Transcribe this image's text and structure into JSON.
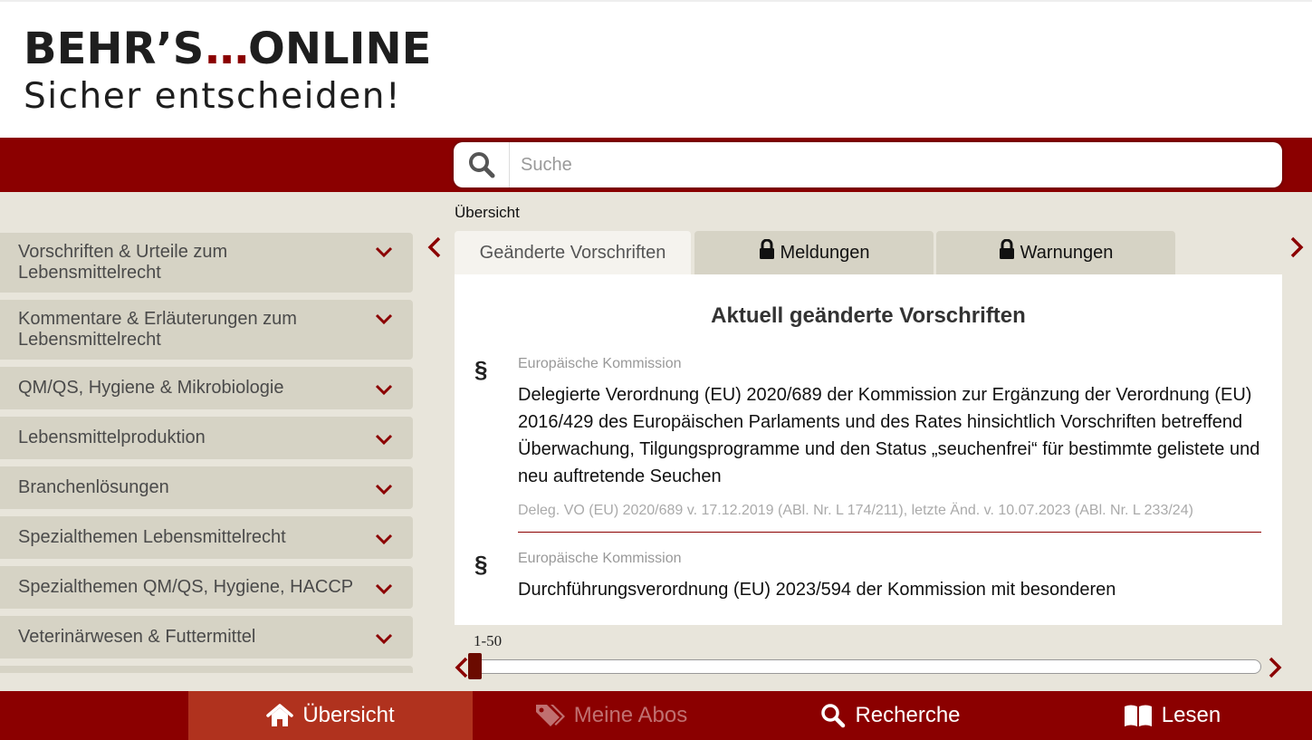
{
  "logo": {
    "brand_left": "BEHR’S",
    "brand_dots": "...",
    "brand_right": "ONLINE",
    "tagline": "Sicher entscheiden!"
  },
  "colors": {
    "brand_red": "#8b0000",
    "active_nav": "#b0321e",
    "sidebar_bg": "#d6d3c5",
    "main_bg": "#e8e5db"
  },
  "search": {
    "placeholder": "Suche",
    "icon": "search-icon"
  },
  "breadcrumb": "Übersicht",
  "sidebar": {
    "items": [
      {
        "label": "Vorschriften & Urteile zum Lebensmittelrecht"
      },
      {
        "label": "Kommentare & Erläuterungen zum Lebensmittelrecht"
      },
      {
        "label": "QM/QS, Hygiene & Mikrobiologie"
      },
      {
        "label": "Lebensmittelproduktion"
      },
      {
        "label": "Branchenlösungen"
      },
      {
        "label": "Spezialthemen Lebensmittelrecht"
      },
      {
        "label": "Spezialthemen QM/QS, Hygiene, HACCP"
      },
      {
        "label": "Veterinärwesen & Futtermittel"
      }
    ]
  },
  "tabs": [
    {
      "label": "Geänderte Vorschriften",
      "active": true,
      "locked": false
    },
    {
      "label": "Meldungen",
      "active": false,
      "locked": true
    },
    {
      "label": "Warnungen",
      "active": false,
      "locked": true
    }
  ],
  "content": {
    "heading": "Aktuell geänderte Vorschriften",
    "entries": [
      {
        "symbol": "§",
        "issuer": "Europäische Kommission",
        "title": "Delegierte Verordnung (EU) 2020/689 der Kommission zur Ergänzung der Verordnung (EU) 2016/429 des Europäischen Parlaments und des Rates hinsichtlich Vorschriften betreffend Überwachung, Tilgungsprogramme und den Status „seuchenfrei“ für bestimmte gelistete und neu auftretende Seuchen",
        "reference": "Deleg. VO (EU) 2020/689 v. 17.12.2019 (ABl. Nr. L 174/211), letzte Änd. v. 10.07.2023 (ABl. Nr. L 233/24)"
      },
      {
        "symbol": "§",
        "issuer": "Europäische Kommission",
        "title": "Durchführungsverordnung (EU) 2023/594 der Kommission mit besonderen"
      }
    ]
  },
  "pager": {
    "range_label": "1-50",
    "position_fraction": 0.0
  },
  "bottom_nav": [
    {
      "label": "Übersicht",
      "icon": "home-icon",
      "active": true,
      "disabled": false
    },
    {
      "label": "Meine Abos",
      "icon": "tags-icon",
      "active": false,
      "disabled": true
    },
    {
      "label": "Recherche",
      "icon": "search-icon",
      "active": false,
      "disabled": false
    },
    {
      "label": "Lesen",
      "icon": "book-icon",
      "active": false,
      "disabled": false
    }
  ]
}
